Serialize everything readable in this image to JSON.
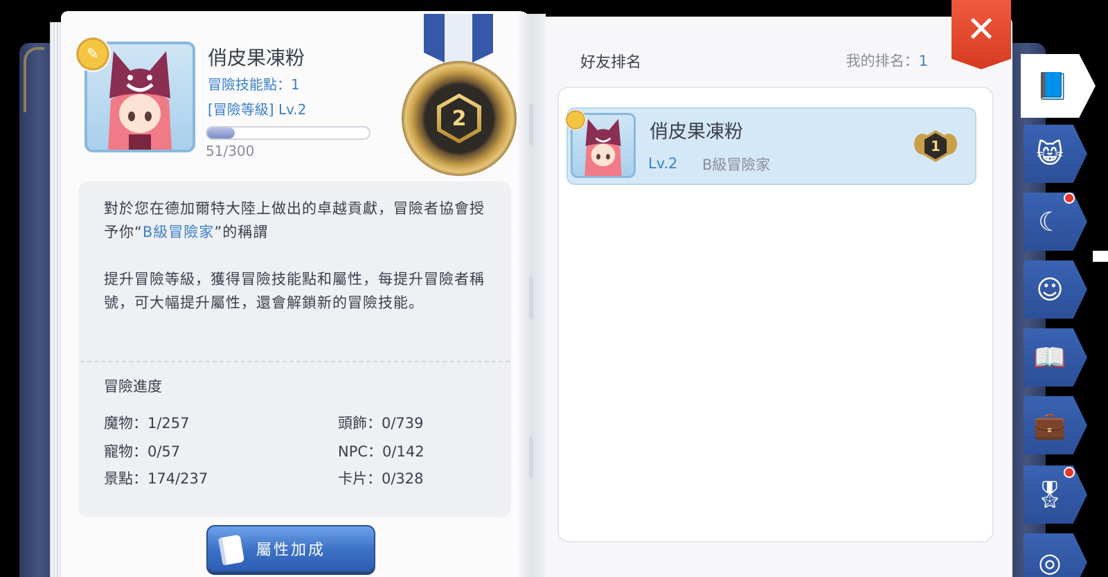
{
  "profile": {
    "name": "俏皮果凍粉",
    "skill_points": "冒險技能點：1",
    "adventure_level": "[冒險等級] Lv.2",
    "exp_text": "51/300",
    "exp_progress": 0.17
  },
  "medal": {
    "rank_number": "2"
  },
  "description": {
    "line1_pre": "對於您在德加爾特大陸上做出的卓越貢獻，冒險者協會授予你",
    "line1_open": "“",
    "line1_highlight": "B級冒險家",
    "line1_close": "”",
    "line1_post": "的稱謂",
    "paragraph2": "提升冒險等級，獲得冒險技能點和屬性，每提升冒險者稱號，可大幅提升屬性，還會解鎖新的冒險技能。"
  },
  "progress": {
    "title": "冒險進度",
    "stats": [
      {
        "label": "魔物：1/257"
      },
      {
        "label": "頭飾：0/739"
      },
      {
        "label": "寵物：0/57"
      },
      {
        "label": "NPC：0/142"
      },
      {
        "label": "景點：174/237"
      },
      {
        "label": "卡片：0/328"
      }
    ]
  },
  "buttons": {
    "attribute_bonus": "屬性加成",
    "close": "✕"
  },
  "ranking": {
    "title": "好友排名",
    "my_rank_label": "我的排名：",
    "my_rank_value": "1",
    "entries": [
      {
        "name": "俏皮果凍粉",
        "level": "Lv.2",
        "title": "B級冒險家",
        "rank": "1"
      }
    ]
  },
  "tabs": [
    {
      "icon": "book-icon",
      "glyph": "📘",
      "active": true,
      "notify": false
    },
    {
      "icon": "grinning-cat-icon",
      "glyph": "😸",
      "active": false,
      "notify": false
    },
    {
      "icon": "cat-ear-icon",
      "glyph": "☾",
      "active": false,
      "notify": true
    },
    {
      "icon": "pet-face-icon",
      "glyph": "☺",
      "active": false,
      "notify": false
    },
    {
      "icon": "open-book-icon",
      "glyph": "📖",
      "active": false,
      "notify": false
    },
    {
      "icon": "briefcase-icon",
      "glyph": "💼",
      "active": false,
      "notify": false
    },
    {
      "icon": "medal-icon",
      "glyph": "🎖",
      "active": false,
      "notify": true
    },
    {
      "icon": "fingerprint-icon",
      "glyph": "◎",
      "active": false,
      "notify": false
    }
  ],
  "colors": {
    "accent_blue": "#3a7fc8",
    "close_red": "#e04a2e",
    "tab_blue": "#3560b5",
    "gold": "#c9a04a"
  }
}
